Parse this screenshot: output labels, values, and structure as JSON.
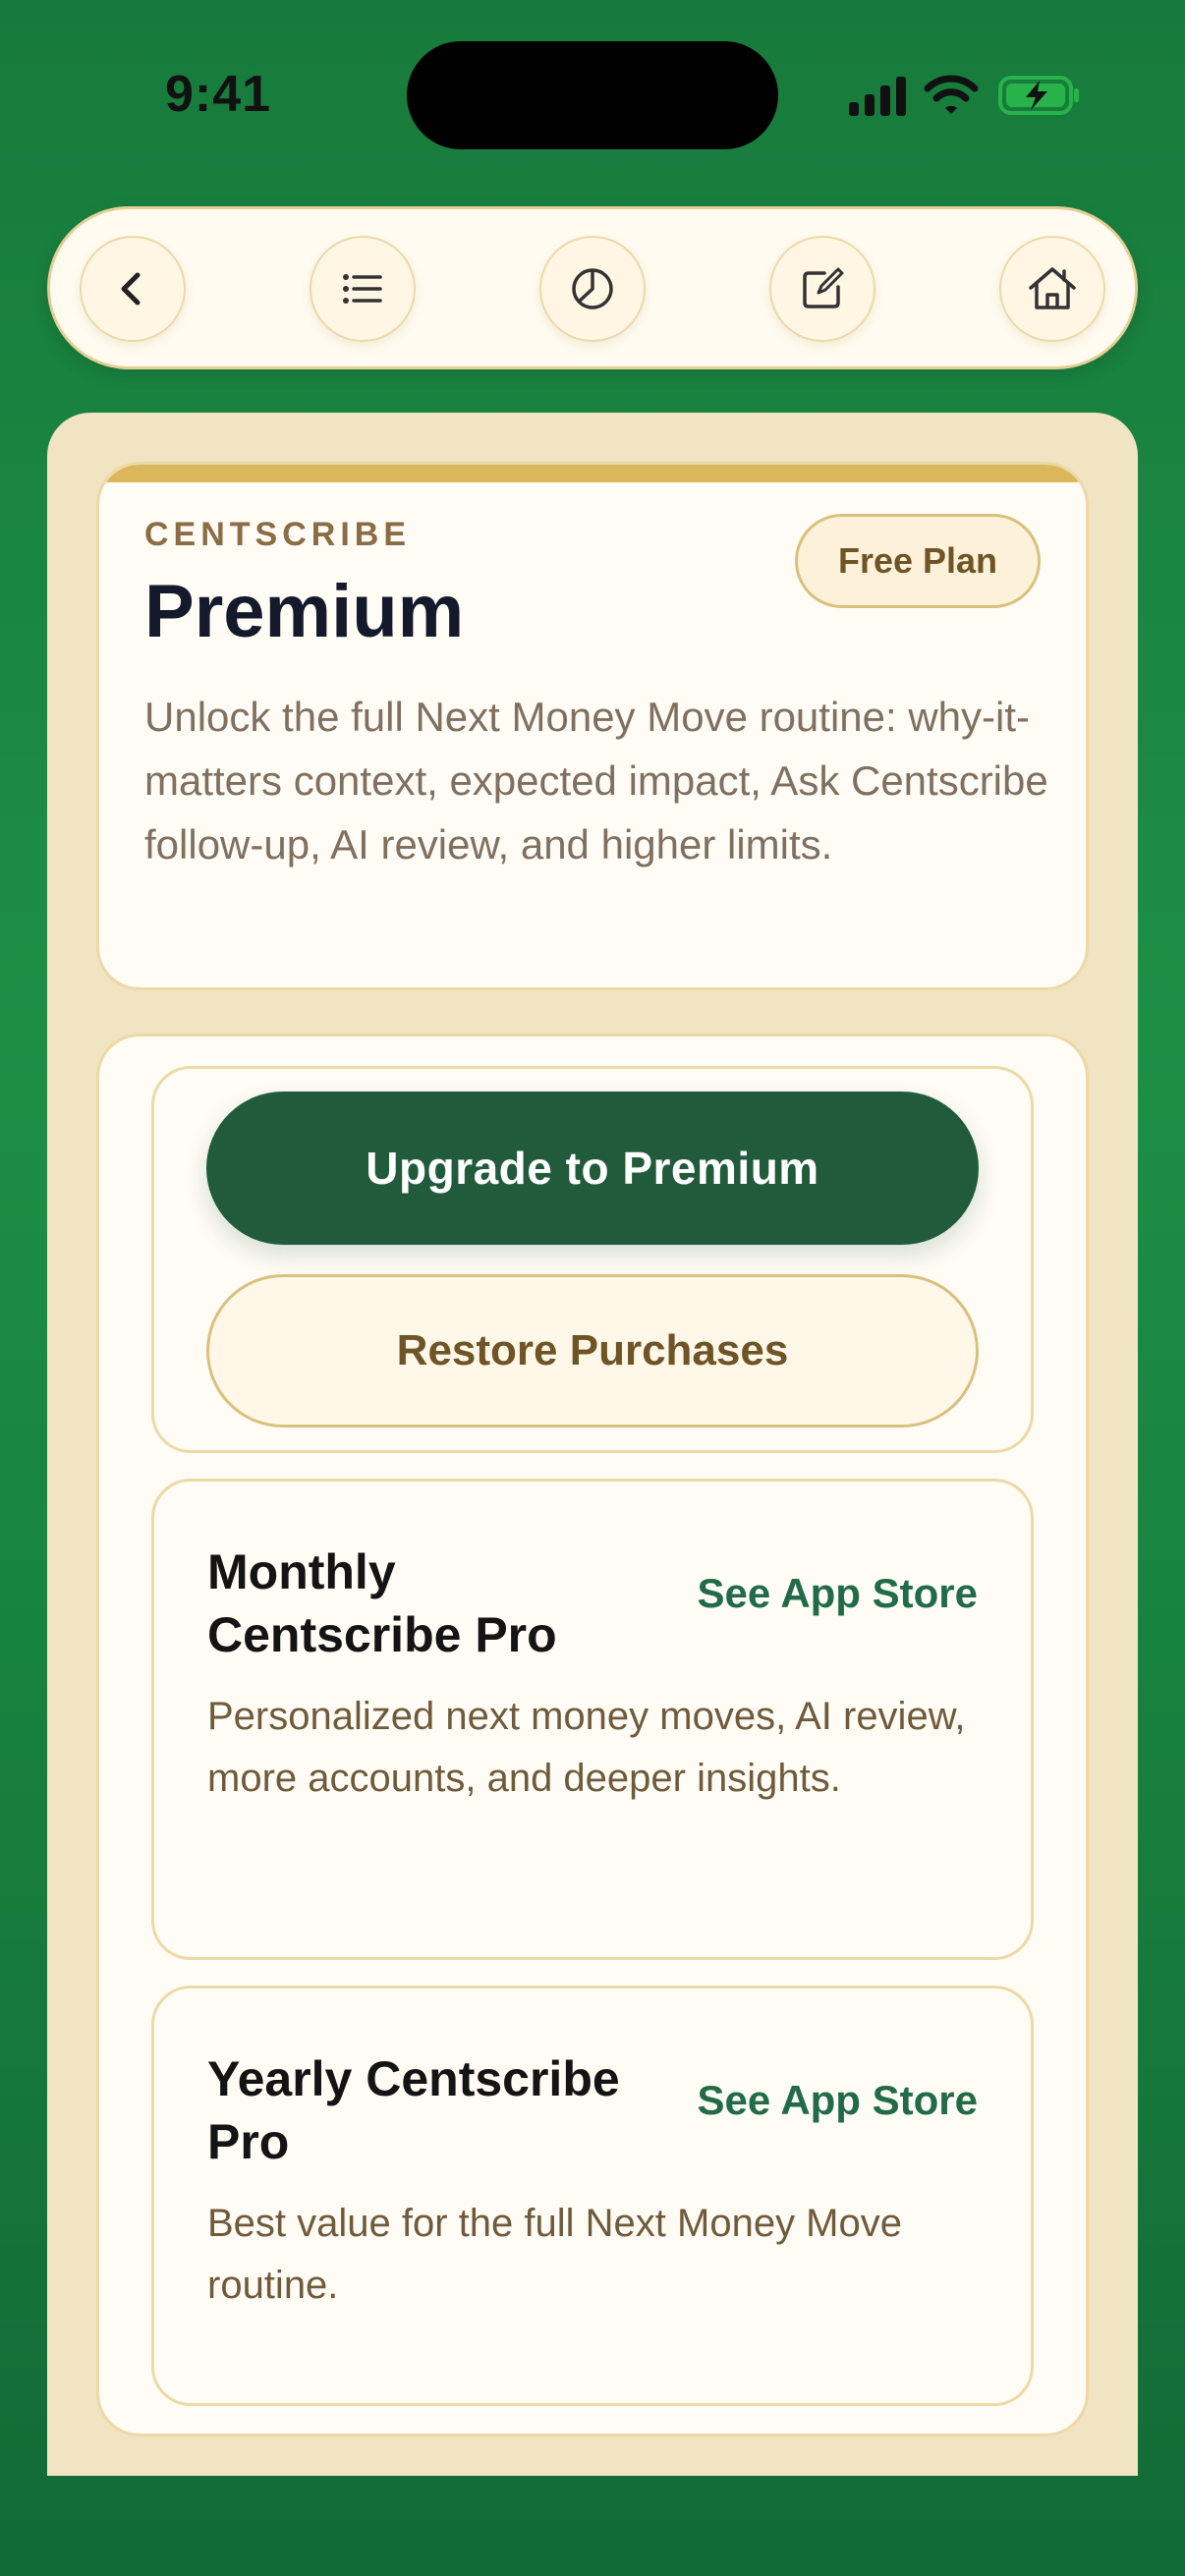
{
  "status_bar": {
    "time": "9:41",
    "icons": [
      "cellular-signal-icon",
      "wifi-icon",
      "battery-charging-icon"
    ]
  },
  "toolbar": {
    "buttons": [
      {
        "icon": "back-chevron-icon"
      },
      {
        "icon": "list-icon"
      },
      {
        "icon": "pie-chart-icon"
      },
      {
        "icon": "edit-note-icon"
      },
      {
        "icon": "home-icon"
      }
    ]
  },
  "header": {
    "eyebrow": "CENTSCRIBE",
    "title": "Premium",
    "badge": "Free Plan",
    "description": "Unlock the full Next Money Move routine: why-it-matters context, expected impact, Ask Centscribe follow-up, AI review, and higher limits."
  },
  "actions": {
    "upgrade_label": "Upgrade to Premium",
    "restore_label": "Restore Purchases"
  },
  "plans": [
    {
      "name": "Monthly Centscribe Pro",
      "link": "See App Store",
      "description": "Personalized next money moves, AI review, more accounts, and deeper insights."
    },
    {
      "name": "Yearly Centscribe Pro",
      "link": "See App Store",
      "description": "Best value for the full Next Money Move routine."
    }
  ],
  "colors": {
    "background_green": "#1d8f45",
    "primary_button": "#215b3b",
    "accent_gold": "#dbb75c",
    "link_green": "#216b47",
    "panel_cream": "#f1e4c3"
  }
}
